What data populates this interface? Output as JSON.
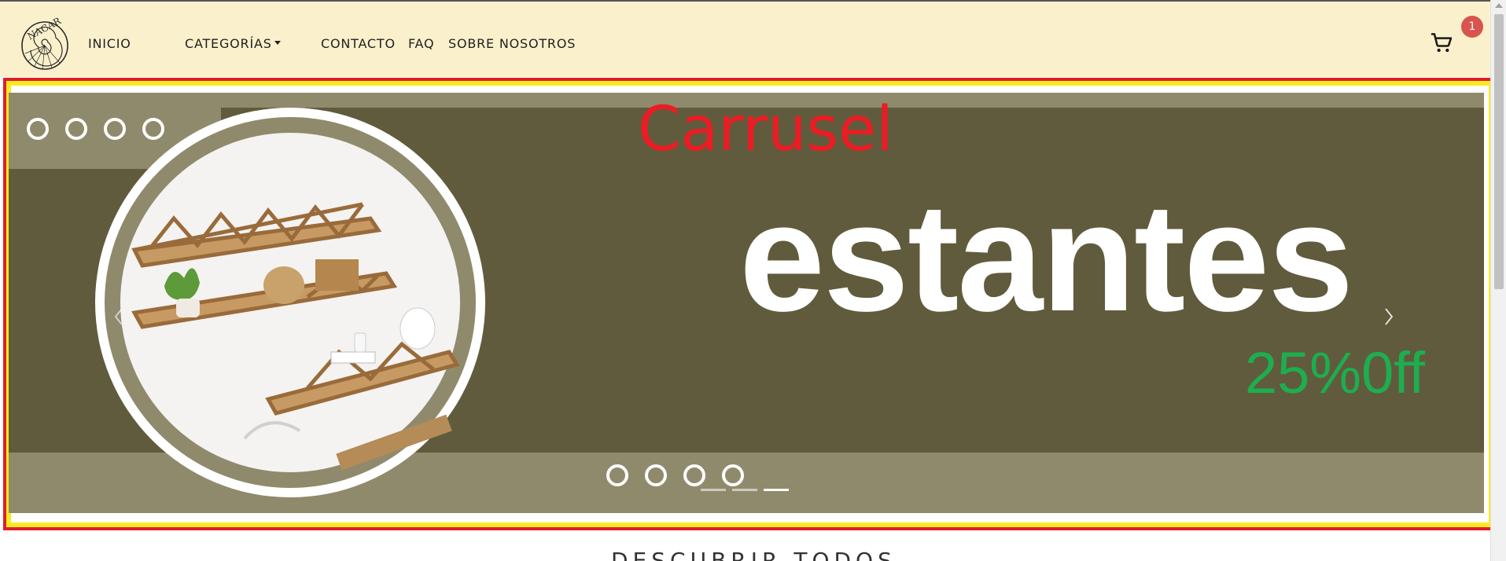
{
  "navbar": {
    "logo_text": "NACAR",
    "links": {
      "inicio": "INICIO",
      "categorias": "CATEGORÍAS",
      "contacto": "CONTACTO",
      "faq": "FAQ",
      "sobre": "SOBRE NOSOTROS"
    },
    "cart_count": "1"
  },
  "carousel": {
    "label": "Carrusel",
    "headline": "estantes",
    "promo": "25%0ff",
    "slide_count": 3,
    "active_slide": 2
  },
  "section": {
    "heading": "DESCUBRIR TODOS"
  },
  "colors": {
    "navbar_bg": "#fbf0cc",
    "slide_dark": "#615b3d",
    "slide_light": "#908a6d",
    "promo": "#1dae4f",
    "label": "#ec1c24",
    "badge": "#d9534f"
  }
}
